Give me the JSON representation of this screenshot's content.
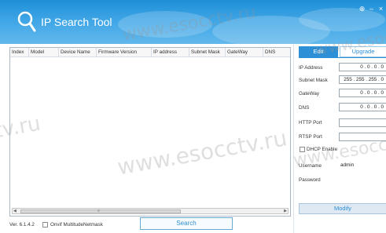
{
  "app": {
    "title": "IP Search Tool",
    "version": "Ver. 6.1.4.2"
  },
  "window_controls": {
    "settings": "⊕",
    "minimize": "–",
    "close": "×"
  },
  "watermark": "www.esocctv.ru",
  "table": {
    "columns": [
      "Index",
      "Model",
      "Device Name",
      "Firmware Version",
      "IP address",
      "Subnet Mask",
      "GateWay",
      "DNS"
    ]
  },
  "footer": {
    "onvif_label": "Onvif MultitudeNetmask",
    "search_label": "Search"
  },
  "panel": {
    "tabs": {
      "edit": "Edit",
      "upgrade": "Upgrade"
    },
    "fields": {
      "ip_address": {
        "label": "IP Address",
        "value": "0 . 0 . 0 . 0"
      },
      "subnet_mask": {
        "label": "Subnet Mask",
        "value": "255 . 255 . 255 . 0"
      },
      "gateway": {
        "label": "GateWay",
        "value": "0 . 0 . 0 . 0"
      },
      "dns": {
        "label": "DNS",
        "value": "0 . 0 . 0 . 0"
      },
      "http_port": {
        "label": "HTTP Port",
        "value": ""
      },
      "rtsp_port": {
        "label": "RTSP Port",
        "value": ""
      },
      "dhcp": {
        "label": "DHCP Enable"
      },
      "username": {
        "label": "Username",
        "value": "admin"
      },
      "password": {
        "label": "Password",
        "value": ""
      }
    },
    "modify_label": "Modify"
  },
  "colors": {
    "header_blue": "#2d8fd5",
    "accent": "#2d8fd5"
  }
}
